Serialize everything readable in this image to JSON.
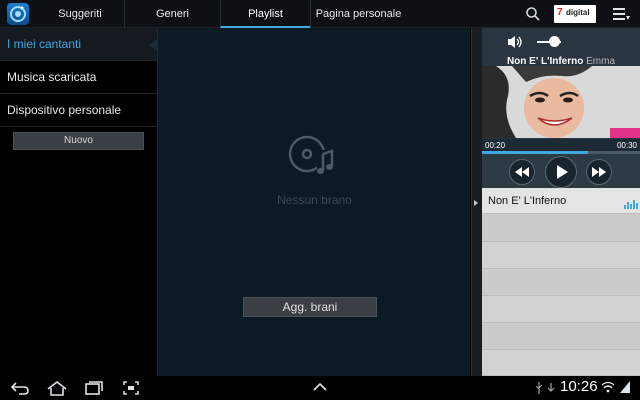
{
  "tabs": [
    {
      "label": "Suggeriti",
      "active": false
    },
    {
      "label": "Generi",
      "active": false
    },
    {
      "label": "Playlist",
      "active": true
    },
    {
      "label": "Pagina personale",
      "active": false
    }
  ],
  "brand": {
    "seven": "7",
    "name": "digital"
  },
  "sidebar": {
    "items": [
      {
        "label": "I miei cantanti",
        "active": true
      },
      {
        "label": "Musica scaricata",
        "active": false
      },
      {
        "label": "Dispositivo personale",
        "active": false
      }
    ],
    "new_button": "Nuovo"
  },
  "center": {
    "empty_text": "Nessun brano",
    "add_button": "Agg. brani"
  },
  "player": {
    "title": "Non E' L'Inferno",
    "artist": "Emma",
    "elapsed": "00:20",
    "total": "00:30",
    "progress": 0.67,
    "volume": 0.7
  },
  "playlist": {
    "now_playing": "Non E' L'Inferno"
  },
  "status": {
    "clock": "10:26"
  },
  "colors": {
    "accent": "#3fa9e0",
    "brand_red": "#e2231a"
  }
}
